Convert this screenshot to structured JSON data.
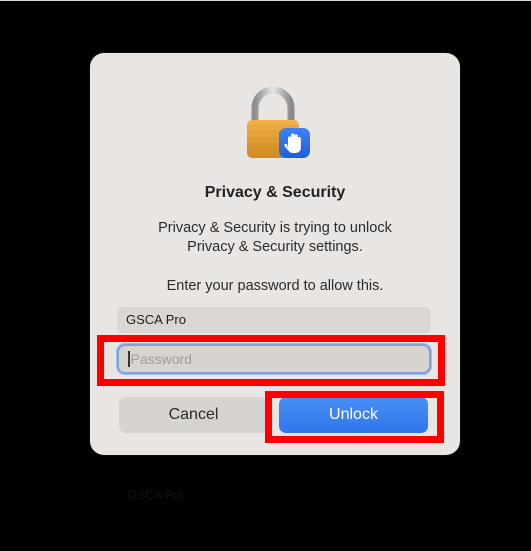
{
  "dialog": {
    "title": "Privacy & Security",
    "message_line1": "Privacy & Security is trying to unlock",
    "message_line2": "Privacy & Security settings.",
    "prompt": "Enter your password to allow this.",
    "username": {
      "value": "GSCA Pro"
    },
    "password": {
      "placeholder": "Password",
      "value": ""
    },
    "buttons": {
      "cancel": "Cancel",
      "unlock": "Unlock"
    },
    "icon": "padlock-with-hand-icon"
  },
  "background": {
    "caption": "GSCA Pro"
  },
  "colors": {
    "screen_background": "#000000",
    "dialog_background": "#e8e5e3",
    "unlock_button": "#3b82f6",
    "annotation_highlight": "#ff0000",
    "focus_ring": "#80a3d9"
  },
  "annotations": [
    {
      "target": "password-field",
      "color": "#ff0000"
    },
    {
      "target": "unlock-button",
      "color": "#ff0000"
    }
  ]
}
